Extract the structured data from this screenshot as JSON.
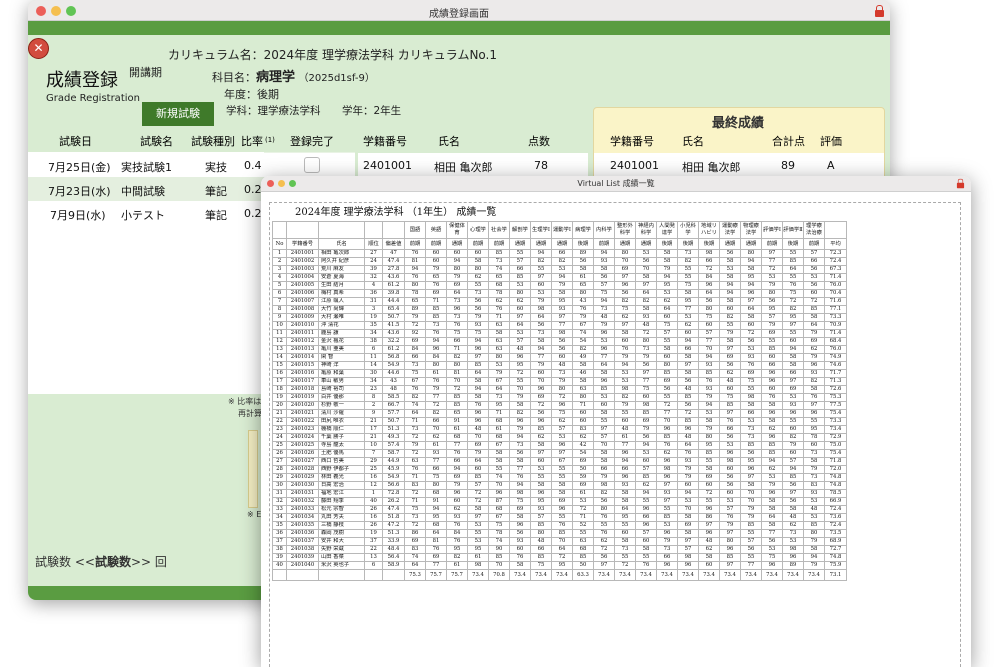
{
  "main_window": {
    "title": "成績登録画面",
    "page_title": "成績登録",
    "page_subtitle": "Grade Registration",
    "exam_period_label": "開講期",
    "curriculum": "カリキュラム名：2024年度 理学療法学科 カリキュラムNo.1",
    "subject_label": "科目名：",
    "subject_name": "病理学",
    "subject_code": "（2025d1sf-9）",
    "year_label": "年度：",
    "year_value": "後期",
    "department": "学科：理学療法学科",
    "grade": "学年：2年生",
    "new_exam_button": "新規試験",
    "close_glyph": "✕",
    "exam_headers": {
      "date": "試験日",
      "name": "試験名",
      "type": "試験種別",
      "ratio": "比率",
      "ratio_note": "(1)",
      "done": "登録完了"
    },
    "student_headers": {
      "id": "学籍番号",
      "name": "氏名",
      "score": "点数"
    },
    "exams": [
      {
        "date": "7月25日(金)",
        "name": "実技試験1",
        "type": "実技",
        "ratio": "0.4"
      },
      {
        "date": "7月23日(水)",
        "name": "中間試験",
        "type": "筆記",
        "ratio": "0.2"
      },
      {
        "date": "7月9日(水)",
        "name": "小テスト",
        "type": "筆記",
        "ratio": "0.2"
      }
    ],
    "student_row": {
      "id": "2401001",
      "name": "相田 亀次郎",
      "score": "78"
    },
    "final": {
      "title": "最終成績",
      "headers": [
        "学籍番号",
        "氏名",
        "合計点",
        "評価"
      ],
      "row": [
        "2401001",
        "相田 亀次郎",
        "89",
        "A"
      ]
    },
    "note1": "※ 比率は",
    "note2": "再計算",
    "note3": "※ E",
    "footer_pre": "試験数 <<",
    "footer_bold": "試験数",
    "footer_post": ">> 回"
  },
  "report_window": {
    "title": "Virtual List 成績一覧",
    "heading": "2024年度 理学療法学科 （1年生） 成績一覧",
    "subjects": [
      "国語",
      "英語",
      "保健体育",
      "心理学",
      "社会学",
      "解剖学",
      "生理学Ⅰ",
      "運動学Ⅰ",
      "病理学",
      "内科学",
      "整形外科学",
      "神経内科学",
      "人間発達学",
      "小児科学",
      "地域リハビリ",
      "運動療法学",
      "物理療法学",
      "評価学Ⅰ",
      "評価学Ⅱ",
      "理学療法治療"
    ],
    "col_headers": {
      "no": "No",
      "student_id": "学籍番号",
      "name": "氏名",
      "rank": "順位",
      "deviation": "偏差値",
      "average": "平均"
    },
    "periods": [
      "前期",
      "前期",
      "通期",
      "前期",
      "前期",
      "通期",
      "通期",
      "通期",
      "後期",
      "前期",
      "通期",
      "通期",
      "後期",
      "後期",
      "後期",
      "通期",
      "通期",
      "前期",
      "後期",
      "前期"
    ],
    "rows": [
      [
        "1",
        "2401001",
        "相田 亀次郎",
        "27",
        "47",
        "76",
        "60",
        "60",
        "60",
        "85",
        "55",
        "94",
        "66",
        "89",
        "94",
        "80",
        "53",
        "58",
        "73",
        "98",
        "56",
        "80",
        "97",
        "55",
        "57",
        "72.3"
      ],
      [
        "2",
        "2401002",
        "阿久井 紀彦",
        "24",
        "47.4",
        "81",
        "60",
        "94",
        "58",
        "73",
        "57",
        "82",
        "82",
        "56",
        "93",
        "70",
        "56",
        "58",
        "82",
        "66",
        "58",
        "94",
        "77",
        "85",
        "66",
        "72.4"
      ],
      [
        "3",
        "2401003",
        "荒川 麻友",
        "39",
        "27.8",
        "94",
        "79",
        "80",
        "80",
        "74",
        "66",
        "55",
        "53",
        "58",
        "58",
        "69",
        "70",
        "79",
        "55",
        "72",
        "53",
        "58",
        "72",
        "64",
        "56",
        "67.3"
      ],
      [
        "4",
        "2401004",
        "安倉 夏海",
        "32",
        "43.6",
        "76",
        "65",
        "79",
        "62",
        "65",
        "85",
        "97",
        "94",
        "61",
        "56",
        "97",
        "58",
        "94",
        "55",
        "84",
        "58",
        "95",
        "53",
        "55",
        "53",
        "71.4"
      ],
      [
        "5",
        "2401005",
        "生田 結月",
        "4",
        "61.2",
        "80",
        "76",
        "69",
        "55",
        "68",
        "53",
        "60",
        "79",
        "65",
        "57",
        "96",
        "97",
        "95",
        "75",
        "96",
        "94",
        "94",
        "79",
        "76",
        "56",
        "76.0"
      ],
      [
        "6",
        "2401006",
        "梅村 真希",
        "36",
        "39.8",
        "78",
        "69",
        "64",
        "73",
        "78",
        "80",
        "53",
        "58",
        "80",
        "75",
        "56",
        "64",
        "53",
        "58",
        "64",
        "94",
        "96",
        "80",
        "75",
        "60",
        "70.4"
      ],
      [
        "7",
        "2401007",
        "江原 颯人",
        "31",
        "44.4",
        "65",
        "71",
        "73",
        "56",
        "62",
        "62",
        "79",
        "95",
        "43",
        "94",
        "82",
        "82",
        "62",
        "95",
        "56",
        "58",
        "97",
        "56",
        "72",
        "72",
        "71.6"
      ],
      [
        "8",
        "2401008",
        "大竹 尚輝",
        "3",
        "65.4",
        "89",
        "85",
        "96",
        "56",
        "76",
        "60",
        "98",
        "93",
        "76",
        "73",
        "75",
        "58",
        "64",
        "77",
        "80",
        "60",
        "64",
        "95",
        "82",
        "85",
        "77.1"
      ],
      [
        "9",
        "2401009",
        "大村 瀬唯",
        "19",
        "50.7",
        "79",
        "85",
        "73",
        "79",
        "71",
        "97",
        "64",
        "97",
        "79",
        "48",
        "62",
        "93",
        "60",
        "53",
        "75",
        "82",
        "58",
        "57",
        "95",
        "58",
        "73.3"
      ],
      [
        "10",
        "2401010",
        "沖 清花",
        "35",
        "41.5",
        "72",
        "73",
        "76",
        "93",
        "63",
        "64",
        "56",
        "77",
        "67",
        "79",
        "97",
        "48",
        "75",
        "62",
        "60",
        "55",
        "60",
        "79",
        "97",
        "64",
        "70.9"
      ],
      [
        "11",
        "2401011",
        "鹿島 謙",
        "34",
        "43.6",
        "92",
        "76",
        "75",
        "75",
        "58",
        "53",
        "73",
        "98",
        "74",
        "96",
        "58",
        "72",
        "57",
        "60",
        "57",
        "79",
        "72",
        "69",
        "55",
        "79",
        "71.4"
      ],
      [
        "12",
        "2401012",
        "金沢 楓花",
        "38",
        "32.2",
        "69",
        "94",
        "66",
        "94",
        "63",
        "57",
        "58",
        "56",
        "54",
        "53",
        "60",
        "80",
        "55",
        "94",
        "77",
        "58",
        "56",
        "55",
        "60",
        "69",
        "68.4"
      ],
      [
        "13",
        "2401013",
        "亀川 亜美",
        "6",
        "61.2",
        "84",
        "96",
        "71",
        "96",
        "63",
        "48",
        "94",
        "56",
        "82",
        "96",
        "76",
        "73",
        "58",
        "66",
        "70",
        "97",
        "53",
        "85",
        "94",
        "62",
        "76.0"
      ],
      [
        "14",
        "2401014",
        "閑 智",
        "11",
        "56.8",
        "66",
        "84",
        "82",
        "97",
        "80",
        "96",
        "77",
        "60",
        "49",
        "77",
        "79",
        "79",
        "60",
        "58",
        "94",
        "69",
        "93",
        "60",
        "58",
        "79",
        "74.9"
      ],
      [
        "15",
        "2401015",
        "神崎 洋",
        "14",
        "54.9",
        "73",
        "80",
        "80",
        "85",
        "53",
        "95",
        "79",
        "48",
        "58",
        "64",
        "94",
        "56",
        "80",
        "97",
        "93",
        "56",
        "76",
        "66",
        "58",
        "96",
        "74.6"
      ],
      [
        "16",
        "2401016",
        "亀原 和葉",
        "30",
        "44.6",
        "75",
        "61",
        "81",
        "64",
        "79",
        "72",
        "60",
        "73",
        "46",
        "58",
        "53",
        "97",
        "85",
        "58",
        "85",
        "62",
        "69",
        "96",
        "66",
        "93",
        "71.7"
      ],
      [
        "17",
        "2401017",
        "車山 敏男",
        "34",
        "43",
        "67",
        "76",
        "70",
        "58",
        "67",
        "55",
        "70",
        "79",
        "58",
        "96",
        "53",
        "77",
        "69",
        "56",
        "76",
        "48",
        "75",
        "96",
        "97",
        "82",
        "71.3"
      ],
      [
        "18",
        "2401018",
        "島崎 裕司",
        "23",
        "48",
        "76",
        "79",
        "72",
        "94",
        "64",
        "70",
        "96",
        "80",
        "63",
        "85",
        "98",
        "75",
        "56",
        "48",
        "93",
        "60",
        "55",
        "60",
        "69",
        "58",
        "72.6"
      ],
      [
        "19",
        "2401019",
        "白井 優那",
        "8",
        "58.5",
        "82",
        "77",
        "85",
        "58",
        "73",
        "79",
        "69",
        "72",
        "80",
        "53",
        "82",
        "60",
        "55",
        "85",
        "79",
        "75",
        "98",
        "76",
        "53",
        "76",
        "75.3"
      ],
      [
        "20",
        "2401020",
        "杉野 敬一",
        "2",
        "66.7",
        "74",
        "72",
        "85",
        "76",
        "95",
        "58",
        "72",
        "96",
        "71",
        "60",
        "79",
        "98",
        "72",
        "56",
        "94",
        "85",
        "58",
        "58",
        "93",
        "97",
        "77.5"
      ],
      [
        "21",
        "2401021",
        "清川 沙羅",
        "9",
        "57.7",
        "64",
        "82",
        "65",
        "96",
        "71",
        "82",
        "56",
        "75",
        "60",
        "58",
        "55",
        "85",
        "77",
        "72",
        "53",
        "97",
        "66",
        "96",
        "96",
        "96",
        "75.4"
      ],
      [
        "22",
        "2401022",
        "田尻 唯衣",
        "21",
        "50.7",
        "71",
        "66",
        "91",
        "96",
        "68",
        "96",
        "96",
        "62",
        "60",
        "55",
        "60",
        "69",
        "70",
        "85",
        "58",
        "76",
        "53",
        "58",
        "55",
        "55",
        "73.3"
      ],
      [
        "23",
        "2401023",
        "棚橋 順仁",
        "17",
        "51.3",
        "73",
        "70",
        "61",
        "48",
        "61",
        "79",
        "85",
        "57",
        "83",
        "97",
        "48",
        "79",
        "96",
        "96",
        "79",
        "66",
        "73",
        "62",
        "60",
        "95",
        "73.4"
      ],
      [
        "24",
        "2401024",
        "千葉 勝子",
        "21",
        "49.3",
        "72",
        "62",
        "68",
        "70",
        "68",
        "94",
        "62",
        "53",
        "62",
        "57",
        "61",
        "56",
        "85",
        "48",
        "80",
        "56",
        "73",
        "96",
        "82",
        "78",
        "72.9"
      ],
      [
        "25",
        "2401025",
        "寺島 龍太",
        "10",
        "57.4",
        "79",
        "61",
        "77",
        "69",
        "67",
        "73",
        "58",
        "96",
        "42",
        "70",
        "77",
        "94",
        "76",
        "64",
        "95",
        "53",
        "85",
        "85",
        "79",
        "60",
        "75.0"
      ],
      [
        "26",
        "2401026",
        "土肥 優馬",
        "7",
        "58.7",
        "72",
        "93",
        "76",
        "79",
        "58",
        "56",
        "97",
        "97",
        "54",
        "58",
        "96",
        "53",
        "62",
        "76",
        "85",
        "96",
        "56",
        "85",
        "60",
        "73",
        "75.4"
      ],
      [
        "27",
        "2401027",
        "西口 哲美",
        "29",
        "44.9",
        "63",
        "77",
        "66",
        "64",
        "58",
        "58",
        "60",
        "67",
        "69",
        "58",
        "94",
        "60",
        "96",
        "93",
        "55",
        "98",
        "95",
        "94",
        "57",
        "58",
        "71.8"
      ],
      [
        "28",
        "2401028",
        "西野 伊都子",
        "25",
        "45.9",
        "76",
        "66",
        "94",
        "60",
        "55",
        "77",
        "53",
        "55",
        "50",
        "66",
        "66",
        "57",
        "98",
        "79",
        "58",
        "60",
        "96",
        "62",
        "94",
        "79",
        "72.0"
      ],
      [
        "29",
        "2401029",
        "林田 義光",
        "16",
        "54.9",
        "71",
        "75",
        "69",
        "85",
        "74",
        "76",
        "55",
        "55",
        "59",
        "79",
        "96",
        "85",
        "96",
        "79",
        "69",
        "56",
        "97",
        "53",
        "85",
        "73",
        "74.8"
      ],
      [
        "30",
        "2401030",
        "日高 宏治",
        "12",
        "56.6",
        "83",
        "80",
        "79",
        "57",
        "70",
        "94",
        "58",
        "58",
        "69",
        "98",
        "93",
        "62",
        "97",
        "60",
        "60",
        "56",
        "58",
        "79",
        "56",
        "83",
        "74.8"
      ],
      [
        "31",
        "2401031",
        "福地 宏江",
        "1",
        "72.8",
        "72",
        "68",
        "96",
        "72",
        "96",
        "98",
        "96",
        "58",
        "61",
        "82",
        "58",
        "94",
        "93",
        "94",
        "72",
        "60",
        "70",
        "96",
        "97",
        "93",
        "78.5"
      ],
      [
        "32",
        "2401032",
        "藤田 翔季",
        "40",
        "26.2",
        "71",
        "91",
        "60",
        "72",
        "87",
        "75",
        "95",
        "69",
        "53",
        "56",
        "58",
        "55",
        "97",
        "53",
        "55",
        "53",
        "70",
        "58",
        "56",
        "53",
        "66.9"
      ],
      [
        "33",
        "2401033",
        "松元 宗智",
        "26",
        "47.4",
        "75",
        "94",
        "62",
        "58",
        "68",
        "69",
        "93",
        "96",
        "72",
        "80",
        "64",
        "96",
        "55",
        "70",
        "96",
        "57",
        "79",
        "58",
        "58",
        "48",
        "72.4"
      ],
      [
        "34",
        "2401034",
        "丸田 芳夫",
        "16",
        "51.8",
        "73",
        "95",
        "93",
        "97",
        "67",
        "58",
        "57",
        "55",
        "71",
        "76",
        "95",
        "66",
        "85",
        "58",
        "86",
        "76",
        "79",
        "64",
        "48",
        "53",
        "73.6"
      ],
      [
        "35",
        "2401035",
        "三橋 静枝",
        "26",
        "47.2",
        "72",
        "68",
        "76",
        "53",
        "75",
        "96",
        "85",
        "76",
        "52",
        "55",
        "55",
        "96",
        "53",
        "69",
        "97",
        "79",
        "85",
        "58",
        "62",
        "85",
        "72.4"
      ],
      [
        "36",
        "2401036",
        "森岡 茂樹",
        "19",
        "51.3",
        "86",
        "64",
        "84",
        "55",
        "78",
        "56",
        "80",
        "85",
        "55",
        "76",
        "60",
        "57",
        "96",
        "58",
        "96",
        "97",
        "55",
        "77",
        "73",
        "80",
        "73.5"
      ],
      [
        "37",
        "2401037",
        "安井 和大",
        "37",
        "33.9",
        "69",
        "81",
        "76",
        "53",
        "74",
        "93",
        "48",
        "70",
        "63",
        "62",
        "58",
        "60",
        "79",
        "97",
        "48",
        "80",
        "57",
        "56",
        "53",
        "79",
        "68.9"
      ],
      [
        "38",
        "2401038",
        "矢野 栄蔵",
        "22",
        "48.4",
        "83",
        "76",
        "95",
        "95",
        "90",
        "60",
        "66",
        "64",
        "68",
        "72",
        "73",
        "58",
        "73",
        "57",
        "62",
        "96",
        "56",
        "53",
        "98",
        "58",
        "72.7"
      ],
      [
        "39",
        "2401039",
        "山田 香菜",
        "13",
        "56.4",
        "74",
        "69",
        "82",
        "61",
        "85",
        "76",
        "85",
        "72",
        "85",
        "56",
        "55",
        "55",
        "66",
        "98",
        "58",
        "85",
        "55",
        "75",
        "96",
        "94",
        "74.8"
      ],
      [
        "40",
        "2401040",
        "米沢 英也子",
        "6",
        "58.9",
        "64",
        "77",
        "61",
        "98",
        "70",
        "58",
        "75",
        "95",
        "50",
        "97",
        "72",
        "76",
        "96",
        "96",
        "60",
        "97",
        "77",
        "96",
        "89",
        "79",
        "75.9"
      ]
    ],
    "totals": [
      "75.3",
      "75.7",
      "75.7",
      "73.4",
      "70.8",
      "73.4",
      "73.4",
      "73.4",
      "63.3",
      "73.4",
      "73.4",
      "73.4",
      "73.4",
      "73.4",
      "73.4",
      "73.4",
      "73.4",
      "73.4",
      "73.4",
      "73.4",
      "73.1"
    ]
  },
  "colors": {
    "titlebar": "#eceaea",
    "accent_green": "#5a9c41",
    "button_green": "#3f7a2a",
    "panel_green": "#d9ecd2",
    "final_yellow": "#faf4c8",
    "close_red": "#d24c3e"
  }
}
